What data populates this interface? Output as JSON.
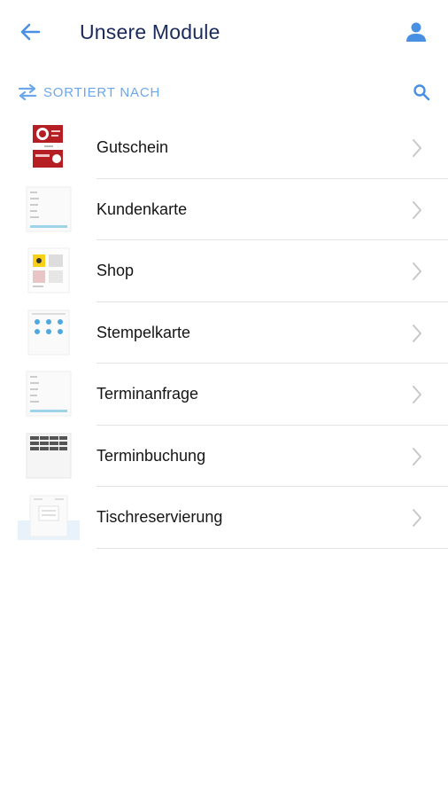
{
  "header": {
    "title": "Unsere Module",
    "back_icon": "arrow-left-icon",
    "profile_icon": "person-icon"
  },
  "toolbar": {
    "sort_label": "SORTIERT NACH",
    "sort_icon": "swap-arrows-icon",
    "search_icon": "search-icon"
  },
  "colors": {
    "title": "#1b2a5a",
    "accent": "#6ea6ec",
    "icon_blue": "#4a90e2",
    "divider": "#e3e3e3",
    "chevron": "#c7c7cc"
  },
  "modules": [
    {
      "label": "Gutschein",
      "thumb_icon": "voucher-thumbnail"
    },
    {
      "label": "Kundenkarte",
      "thumb_icon": "customer-card-thumbnail"
    },
    {
      "label": "Shop",
      "thumb_icon": "shop-thumbnail"
    },
    {
      "label": "Stempelkarte",
      "thumb_icon": "stamp-card-thumbnail"
    },
    {
      "label": "Terminanfrage",
      "thumb_icon": "appointment-request-thumbnail"
    },
    {
      "label": "Terminbuchung",
      "thumb_icon": "appointment-booking-thumbnail"
    },
    {
      "label": "Tischreservierung",
      "thumb_icon": "table-reservation-thumbnail"
    }
  ]
}
